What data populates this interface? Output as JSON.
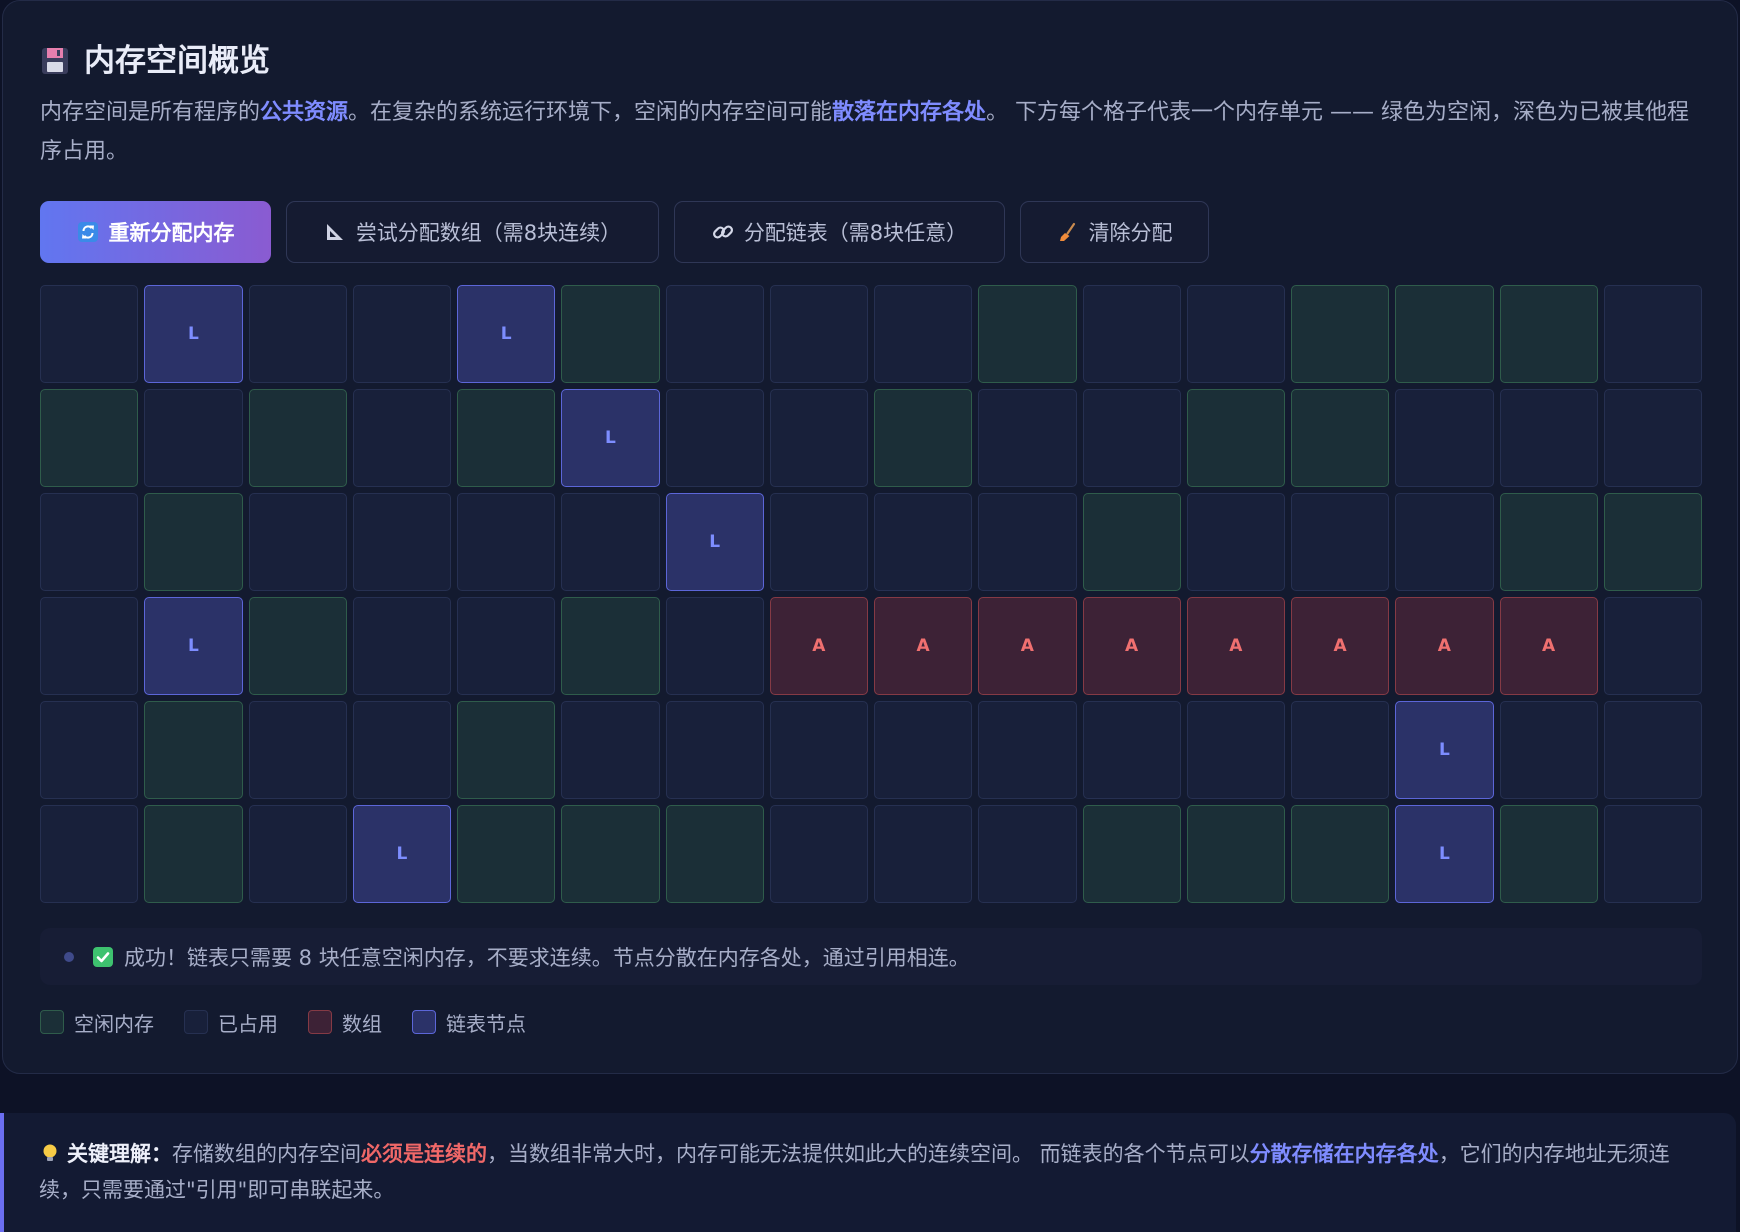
{
  "panel": {
    "icon": "floppy-disk-icon",
    "title": "内存空间概览",
    "description": [
      {
        "text": "内存空间是所有程序的"
      },
      {
        "text": "公共资源",
        "highlight": true
      },
      {
        "text": "。在复杂的系统运行环境下，空闲的内存空间可能"
      },
      {
        "text": "散落在内存各处",
        "highlight": true
      },
      {
        "text": "。 下方每个格子代表一个内存单元 —— 绿色为空闲，深色为已被其他程序占用。"
      }
    ]
  },
  "toolbar": {
    "buttons": [
      {
        "icon": "refresh-icon",
        "label": "重新分配内存",
        "primary": true
      },
      {
        "icon": "triangle-ruler-icon",
        "label": "尝试分配数组（需8块连续）"
      },
      {
        "icon": "link-icon",
        "label": "分配链表（需8块任意）"
      },
      {
        "icon": "broom-icon",
        "label": "清除分配"
      }
    ]
  },
  "memory": {
    "columns": 16,
    "marks": [
      "",
      "",
      "A",
      "L"
    ],
    "rows": [
      [
        1,
        3,
        1,
        1,
        3,
        0,
        1,
        1,
        1,
        0,
        1,
        1,
        0,
        0,
        0,
        1
      ],
      [
        0,
        1,
        0,
        1,
        0,
        3,
        1,
        1,
        0,
        1,
        1,
        0,
        0,
        1,
        1,
        1
      ],
      [
        1,
        0,
        1,
        1,
        1,
        1,
        3,
        1,
        1,
        1,
        0,
        1,
        1,
        1,
        0,
        0
      ],
      [
        1,
        3,
        0,
        1,
        1,
        0,
        1,
        2,
        2,
        2,
        2,
        2,
        2,
        2,
        2,
        1
      ],
      [
        1,
        0,
        1,
        1,
        0,
        1,
        1,
        1,
        1,
        1,
        1,
        1,
        1,
        3,
        1,
        1
      ],
      [
        1,
        0,
        1,
        3,
        0,
        0,
        0,
        1,
        1,
        1,
        0,
        0,
        0,
        3,
        0,
        1
      ]
    ]
  },
  "status": {
    "icon": "check-mark-icon",
    "text": "成功！链表只需要 8 块任意空闲内存，不要求连续。节点分散在内存各处，通过引用相连。"
  },
  "legend": [
    {
      "label": "空闲内存"
    },
    {
      "label": "已占用"
    },
    {
      "label": "数组"
    },
    {
      "label": "链表节点"
    }
  ],
  "note": {
    "icon": "light-bulb-icon",
    "label": "关键理解：",
    "segments": [
      {
        "text": "存储数组的内存空间"
      },
      {
        "text": "必须是连续的",
        "emphasis": "red"
      },
      {
        "text": "，当数组非常大时，内存可能无法提供如此大的连续空间。 而链表的各个节点可以"
      },
      {
        "text": "分散存储在内存各处",
        "emphasis": "blue"
      },
      {
        "text": "，它们的内存地址无须连续，只需要通过\"引用\"即可串联起来。"
      }
    ]
  },
  "colors": {
    "accent": "#7f8cff",
    "danger": "#f06868",
    "free_fill": "#1b2f37",
    "free_border": "#2f5c4b",
    "occupied_fill": "#18203a",
    "occupied_border": "#263051",
    "array_fill": "#3d2236",
    "array_border": "#853a45",
    "array_text": "#f07070",
    "list_fill": "#2b3268",
    "list_border": "#5c66d8",
    "list_text": "#7d8dff",
    "primary_gradient": [
      "#6176f0",
      "#8a5bd1"
    ]
  }
}
